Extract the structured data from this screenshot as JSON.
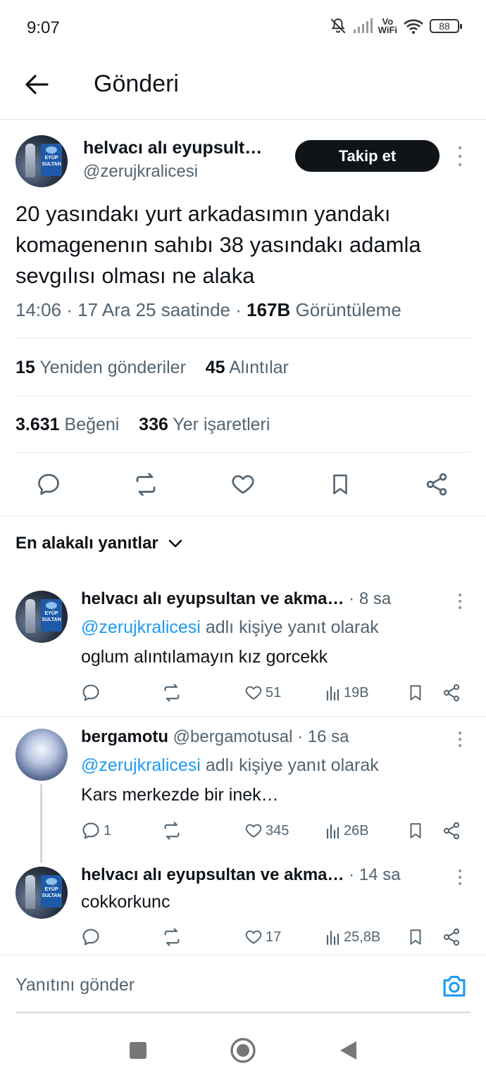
{
  "status_bar": {
    "time": "9:07",
    "wifi_label_top": "Vo",
    "wifi_label_bottom": "WiFi",
    "battery": "88"
  },
  "header": {
    "title": "Gönderi"
  },
  "main_post": {
    "author_name": "helvacı alı eyupsult…",
    "handle": "@zerujkralicesi",
    "follow_label": "Takip et",
    "text": "20 yasındakı yurt arkadasımın yandakı komagenenın sahıbı 38 yasındakı adamla sevgılısı olması ne alaka",
    "meta_time": "14:06 · 17 Ara 25 saatinde · ",
    "views_count": "167B",
    "views_label": " Görüntüleme",
    "reposts_count": "15",
    "reposts_label": "Yeniden gönderiler",
    "quotes_count": "45",
    "quotes_label": "Alıntılar",
    "likes_count": "3.631",
    "likes_label": "Beğeni",
    "bookmarks_count": "336",
    "bookmarks_label": "Yer işaretleri"
  },
  "sort": {
    "label": "En alakalı yanıtlar"
  },
  "replies": [
    {
      "author": "helvacı alı eyupsultan ve akma…",
      "meta": " · 8 sa",
      "reply_mention": "@zerujkralicesi",
      "reply_suffix": " adlı kişiye yanıt olarak",
      "text": "oglum alıntılamayın kız gorcekk",
      "comments": "",
      "likes": "51",
      "views": "19B"
    },
    {
      "author": "bergamotu",
      "meta": " @bergamotusal · 16 sa",
      "reply_mention": "@zerujkralicesi",
      "reply_suffix": " adlı kişiye yanıt olarak",
      "text": "Kars merkezde bir inek…",
      "comments": "1",
      "likes": "345",
      "views": "26B"
    },
    {
      "author": "helvacı alı eyupsultan ve akma…",
      "meta": " · 14 sa",
      "text": "cokkorkunc",
      "comments": "",
      "likes": "17",
      "views": "25,8B"
    }
  ],
  "compose": {
    "placeholder": "Yanıtını gönder"
  },
  "colors": {
    "accent": "#1d9bf0",
    "text": "#0f1419",
    "muted": "#536471"
  }
}
